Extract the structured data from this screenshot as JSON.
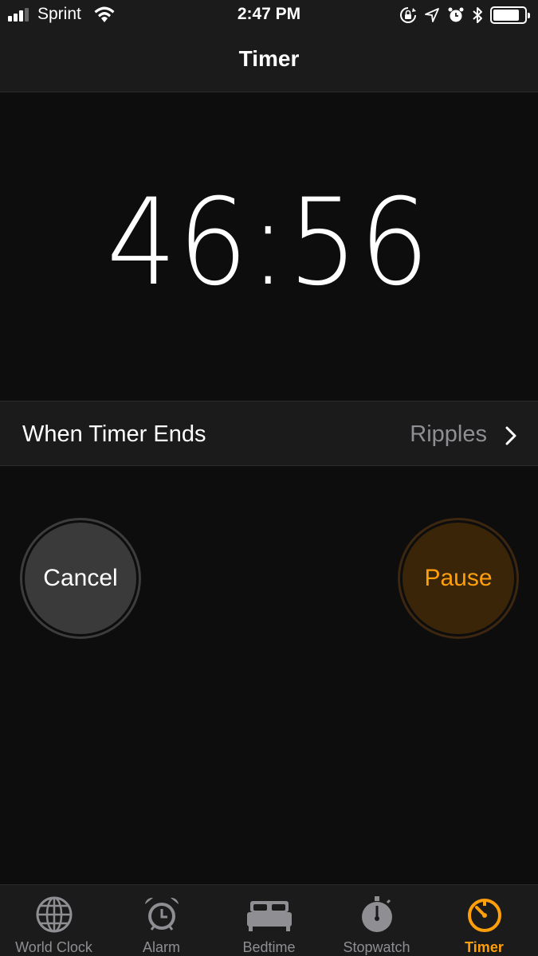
{
  "status_bar": {
    "carrier": "Sprint",
    "time": "2:47 PM",
    "signal_bars": 3,
    "battery_level": 0.85
  },
  "nav": {
    "title": "Timer"
  },
  "timer": {
    "remaining": "46:56"
  },
  "when_timer_ends": {
    "label": "When Timer Ends",
    "value": "Ripples"
  },
  "buttons": {
    "cancel": "Cancel",
    "pause": "Pause"
  },
  "colors": {
    "accent": "#ff9f0a",
    "secondary_text": "#8e8e93",
    "background": "#0d0d0d",
    "bar": "#1b1b1b"
  },
  "tabs": [
    {
      "label": "World Clock",
      "icon": "globe-icon"
    },
    {
      "label": "Alarm",
      "icon": "alarm-clock-icon"
    },
    {
      "label": "Bedtime",
      "icon": "bed-icon"
    },
    {
      "label": "Stopwatch",
      "icon": "stopwatch-icon"
    },
    {
      "label": "Timer",
      "icon": "timer-icon",
      "active": true
    }
  ]
}
